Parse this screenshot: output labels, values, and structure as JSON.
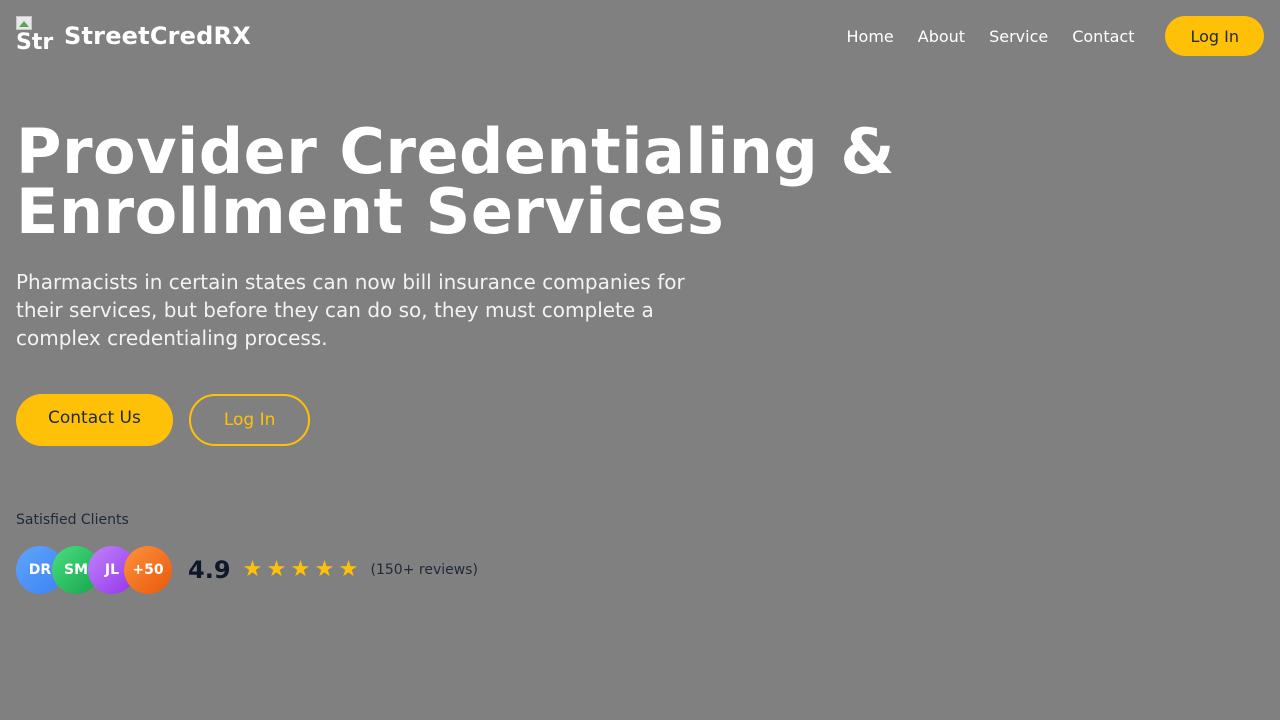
{
  "brand": {
    "logo_alt": "Str",
    "name": "StreetCredRX"
  },
  "nav": {
    "items": [
      "Home",
      "About",
      "Service",
      "Contact"
    ],
    "login_label": "Log In"
  },
  "hero": {
    "title_line1": "Provider Credentialing &",
    "title_line2": "Enrollment Services",
    "subtitle": "Pharmacists in certain states can now bill insurance companies for their services, but before they can do so, they must complete a complex credentialing process.",
    "primary_cta": "Contact Us",
    "secondary_cta": "Log In"
  },
  "social_proof": {
    "label": "Satisfied Clients",
    "avatars": [
      {
        "initials": "DR",
        "color_from": "#60a5fa",
        "color_to": "#3b82f6"
      },
      {
        "initials": "SM",
        "color_from": "#4ade80",
        "color_to": "#16a34a"
      },
      {
        "initials": "JL",
        "color_from": "#c084fc",
        "color_to": "#9333ea"
      },
      {
        "initials": "+50",
        "color_from": "#fb923c",
        "color_to": "#ea580c"
      }
    ],
    "rating": "4.9",
    "stars": 5,
    "reviews": "(150+ reviews)"
  },
  "colors": {
    "accent": "#ffc107",
    "background": "#808080",
    "text_dark": "#1f2937"
  }
}
